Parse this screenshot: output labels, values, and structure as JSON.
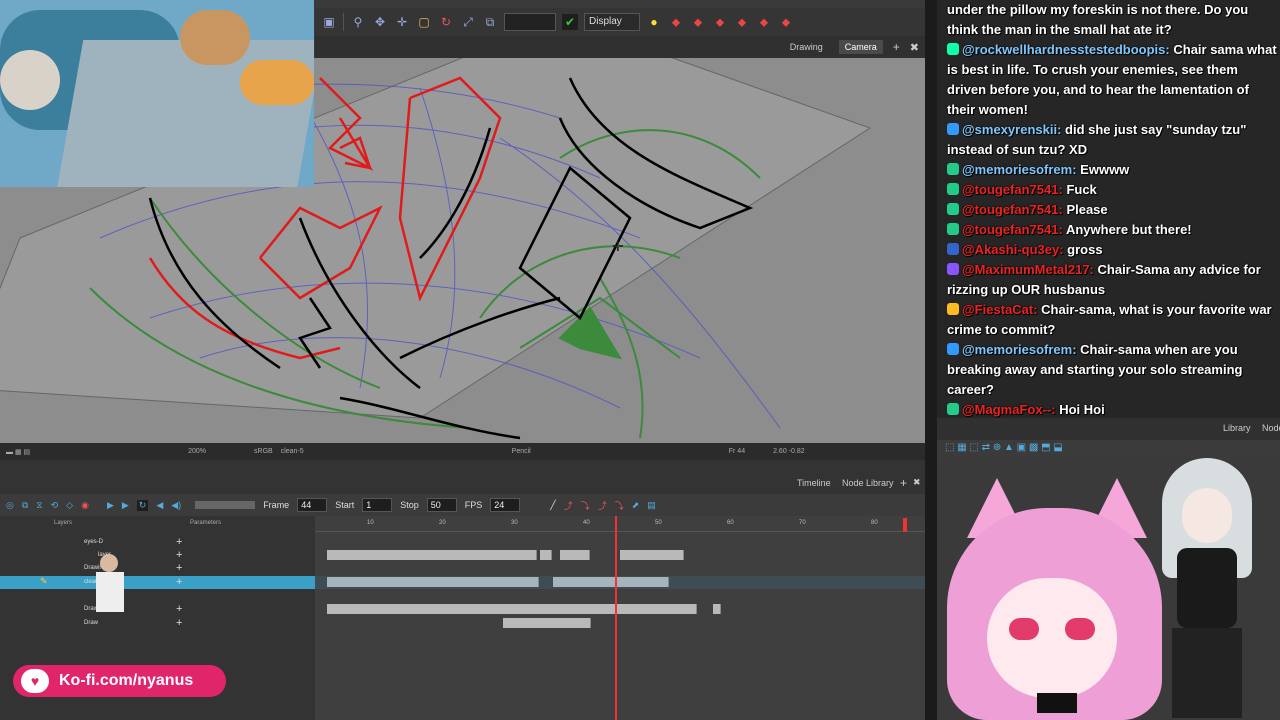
{
  "toolbar": {
    "display_label": "Display"
  },
  "view_tabs": [
    "Drawing",
    "Camera"
  ],
  "view_status": {
    "zoom": "200%",
    "color_space": "sRGB",
    "layer": "clean-5",
    "tool": "Pencil",
    "frame": "Fr 44",
    "coords": "2.60 -0.82"
  },
  "timeline": {
    "tabs": [
      "Timeline",
      "Node Library"
    ],
    "frame_label": "Frame",
    "frame_value": "44",
    "start_label": "Start",
    "start_value": "1",
    "stop_label": "Stop",
    "stop_value": "50",
    "fps_label": "FPS",
    "fps_value": "24",
    "layers_header": "Layers",
    "params_header": "Parameters",
    "ruler": [
      "10",
      "20",
      "30",
      "40",
      "50",
      "60",
      "70",
      "80"
    ],
    "layers": [
      "eyes-D",
      "layer",
      "Drawing",
      "clean",
      "Drawing_2",
      "Drawing_3"
    ]
  },
  "chat": {
    "messages": [
      {
        "user": "",
        "text": "under the pillow my foreskin is not there. Do you think the man in the small hat ate it?"
      },
      {
        "user": "@rockwellhardnesstestedboopis:",
        "text": "Chair sama what is best in life. To crush your enemies, see them driven before you, and to hear the lamentation of their women!"
      },
      {
        "user": "@smexyrenskii:",
        "text": "did she just say \"sunday tzu\" instead of sun tzu? XD"
      },
      {
        "user": "@memoriesofrem:",
        "text": "Ewwww"
      },
      {
        "user": "@tougefan7541:",
        "text": "Fuck"
      },
      {
        "user": "@tougefan7541:",
        "text": "Please"
      },
      {
        "user": "@tougefan7541:",
        "text": "Anywhere but there!"
      },
      {
        "user": "@Akashi-qu3ey:",
        "text": "gross"
      },
      {
        "user": "@MaximumMetal217:",
        "text": "Chair-Sama any advice for rizzing up OUR husbanus"
      },
      {
        "user": "@FiestaCat:",
        "text": "Chair-sama, what is your favorite war crime to commit?"
      },
      {
        "user": "@memoriesofrem:",
        "text": "Chair-sama when are you breaking away and starting your solo streaming career?"
      },
      {
        "user": "@MagmaFox--:",
        "text": "Hoi Hoi"
      }
    ]
  },
  "node_panel": {
    "tabs": [
      "Library",
      "Node"
    ]
  },
  "kofi": {
    "text": "Ko-fi.com/nyanus"
  }
}
